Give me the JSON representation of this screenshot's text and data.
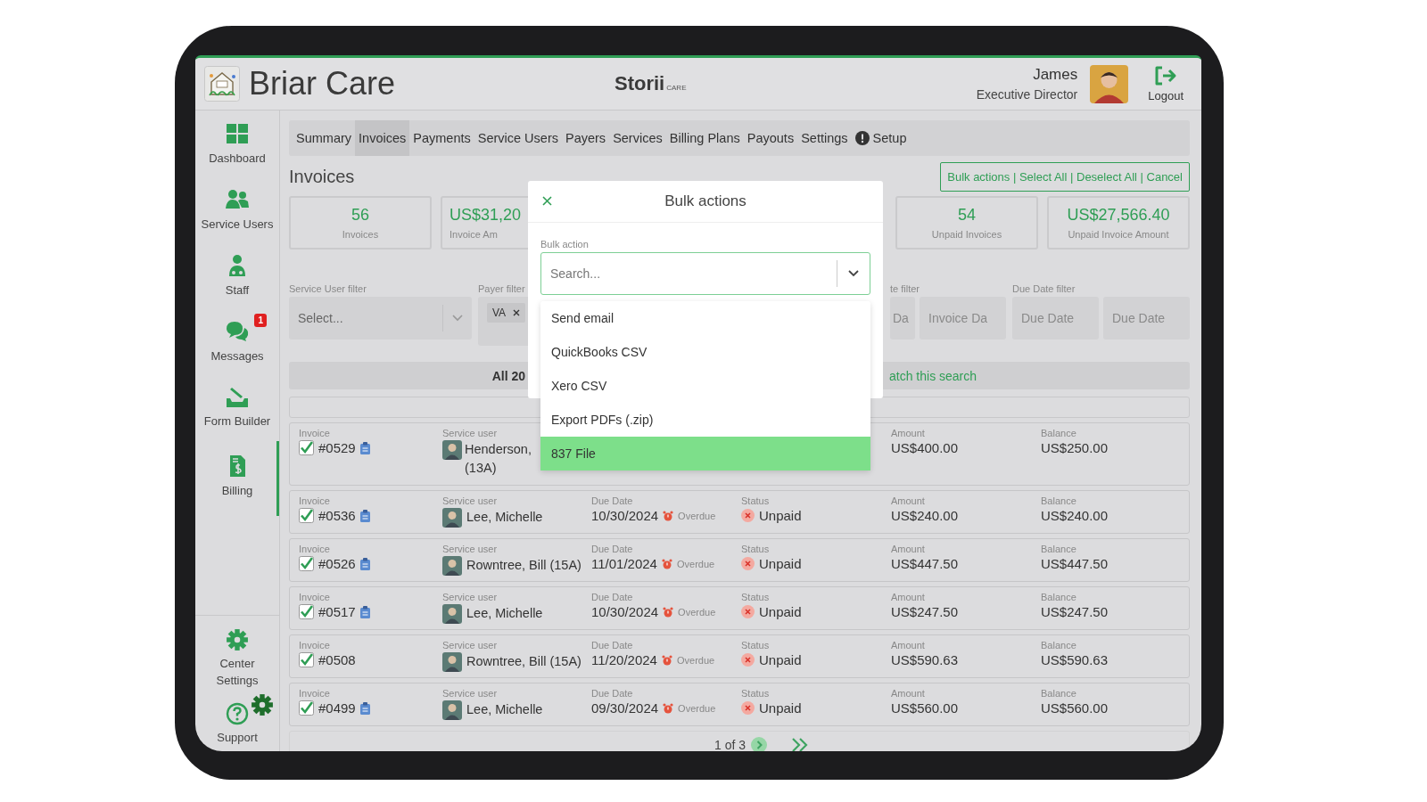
{
  "header": {
    "brand": "Briar Care",
    "product": "Storii",
    "product_tag": "CARE",
    "user_name": "James",
    "user_role": "Executive Director",
    "logout": "Logout"
  },
  "sidebar": {
    "items": [
      {
        "label": "Dashboard",
        "selected": false
      },
      {
        "label": "Service Users",
        "selected": false
      },
      {
        "label": "Staff",
        "selected": false
      },
      {
        "label": "Messages",
        "selected": false,
        "badge": "1"
      },
      {
        "label": "Form Builder",
        "selected": false
      },
      {
        "label": "Billing",
        "selected": true
      }
    ],
    "bottom_items": [
      {
        "label": "Center Settings"
      },
      {
        "label": "Support"
      }
    ]
  },
  "tabs": [
    {
      "label": "Summary",
      "selected": false
    },
    {
      "label": "Invoices",
      "selected": true
    },
    {
      "label": "Payments",
      "selected": false
    },
    {
      "label": "Service Users",
      "selected": false
    },
    {
      "label": "Payers",
      "selected": false
    },
    {
      "label": "Services",
      "selected": false
    },
    {
      "label": "Billing Plans",
      "selected": false
    },
    {
      "label": "Payouts",
      "selected": false
    },
    {
      "label": "Settings",
      "selected": false
    },
    {
      "label": "Setup",
      "selected": false,
      "alert": true
    }
  ],
  "page_title": "Invoices",
  "bulk_actions_bar": "Bulk actions | Select All | Deselect All | Cancel",
  "stats": [
    {
      "value": "56",
      "label": "Invoices"
    },
    {
      "value": "US$31,20",
      "label": "Invoice Am"
    },
    {
      "value": "54",
      "label": "Unpaid Invoices"
    },
    {
      "value": "US$27,566.40",
      "label": "Unpaid Invoice Amount"
    }
  ],
  "filters": {
    "service_user": {
      "label": "Service User filter",
      "placeholder": "Select..."
    },
    "payer": {
      "label": "Payer filter",
      "chips": [
        "VA"
      ]
    },
    "invoice_date": {
      "label": "te filter",
      "placeholders": [
        "Da",
        "Invoice Da"
      ]
    },
    "due_date": {
      "label": "Due Date filter",
      "placeholders": [
        "Due Date",
        "Due Date"
      ]
    }
  },
  "results_banner": {
    "count": "All 20",
    "message": "atch this search"
  },
  "rows": [
    {
      "checked": true,
      "invoice": {
        "label": "Invoice",
        "value": "#0529",
        "clipboard": true
      },
      "service_user": {
        "label": "Service user",
        "value": "Henderson, (13A)"
      },
      "amount": {
        "label": "Amount",
        "value": "US$400.00"
      },
      "balance": {
        "label": "Balance",
        "value": "US$250.00"
      }
    },
    {
      "checked": true,
      "invoice": {
        "label": "Invoice",
        "value": "#0536",
        "clipboard": true
      },
      "service_user": {
        "label": "Service user",
        "value": "Lee, Michelle"
      },
      "due_date": {
        "label": "Due Date",
        "value": "10/30/2024",
        "overdue": "Overdue"
      },
      "status": {
        "label": "Status",
        "value": "Unpaid"
      },
      "amount": {
        "label": "Amount",
        "value": "US$240.00"
      },
      "balance": {
        "label": "Balance",
        "value": "US$240.00"
      }
    },
    {
      "checked": true,
      "invoice": {
        "label": "Invoice",
        "value": "#0526",
        "clipboard": true
      },
      "service_user": {
        "label": "Service user",
        "value": "Rowntree, Bill (15A)"
      },
      "due_date": {
        "label": "Due Date",
        "value": "11/01/2024",
        "overdue": "Overdue"
      },
      "status": {
        "label": "Status",
        "value": "Unpaid"
      },
      "amount": {
        "label": "Amount",
        "value": "US$447.50"
      },
      "balance": {
        "label": "Balance",
        "value": "US$447.50"
      }
    },
    {
      "checked": true,
      "invoice": {
        "label": "Invoice",
        "value": "#0517",
        "clipboard": true
      },
      "service_user": {
        "label": "Service user",
        "value": "Lee, Michelle"
      },
      "due_date": {
        "label": "Due Date",
        "value": "10/30/2024",
        "overdue": "Overdue"
      },
      "status": {
        "label": "Status",
        "value": "Unpaid"
      },
      "amount": {
        "label": "Amount",
        "value": "US$247.50"
      },
      "balance": {
        "label": "Balance",
        "value": "US$247.50"
      }
    },
    {
      "checked": true,
      "invoice": {
        "label": "Invoice",
        "value": "#0508",
        "clipboard": false
      },
      "service_user": {
        "label": "Service user",
        "value": "Rowntree, Bill (15A)"
      },
      "due_date": {
        "label": "Due Date",
        "value": "11/20/2024",
        "overdue": "Overdue"
      },
      "status": {
        "label": "Status",
        "value": "Unpaid"
      },
      "amount": {
        "label": "Amount",
        "value": "US$590.63"
      },
      "balance": {
        "label": "Balance",
        "value": "US$590.63"
      }
    },
    {
      "checked": true,
      "invoice": {
        "label": "Invoice",
        "value": "#0499",
        "clipboard": true
      },
      "service_user": {
        "label": "Service user",
        "value": "Lee, Michelle"
      },
      "due_date": {
        "label": "Due Date",
        "value": "09/30/2024",
        "overdue": "Overdue"
      },
      "status": {
        "label": "Status",
        "value": "Unpaid"
      },
      "amount": {
        "label": "Amount",
        "value": "US$560.00"
      },
      "balance": {
        "label": "Balance",
        "value": "US$560.00"
      }
    }
  ],
  "pagination": {
    "page": "1 of 3"
  },
  "modal": {
    "title": "Bulk actions",
    "field_label": "Bulk action",
    "placeholder": "Search...",
    "options": [
      {
        "label": "Send email",
        "selected": false
      },
      {
        "label": "QuickBooks CSV",
        "selected": false
      },
      {
        "label": "Xero CSV",
        "selected": false
      },
      {
        "label": "Export PDFs (.zip)",
        "selected": false
      },
      {
        "label": "837 File",
        "selected": true
      }
    ]
  }
}
